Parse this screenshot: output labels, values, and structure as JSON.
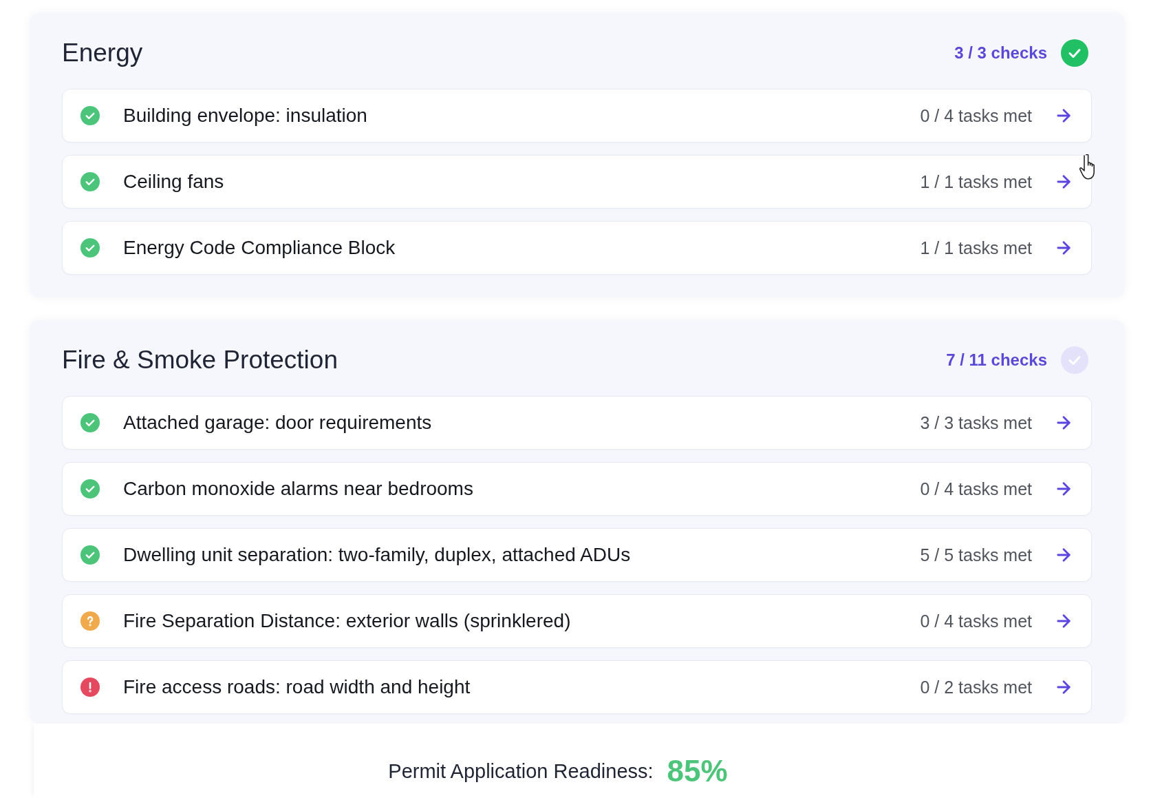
{
  "sections": [
    {
      "title": "Energy",
      "checks": "3 / 3 checks",
      "complete": true,
      "items": [
        {
          "kind": "met",
          "label": "Building envelope: insulation",
          "tasks": "0 / 4 tasks met"
        },
        {
          "kind": "met",
          "label": "Ceiling fans",
          "tasks": "1 / 1 tasks met"
        },
        {
          "kind": "met",
          "label": "Energy Code Compliance Block",
          "tasks": "1 / 1 tasks met"
        }
      ]
    },
    {
      "title": "Fire & Smoke Protection",
      "checks": "7 / 11 checks",
      "complete": false,
      "items": [
        {
          "kind": "met",
          "label": "Attached garage: door requirements",
          "tasks": "3 / 3 tasks met"
        },
        {
          "kind": "met",
          "label": "Carbon monoxide alarms near bedrooms",
          "tasks": "0 / 4 tasks met"
        },
        {
          "kind": "met",
          "label": "Dwelling unit separation: two-family, duplex, attached ADUs",
          "tasks": "5 / 5 tasks met"
        },
        {
          "kind": "unknown",
          "label": "Fire Separation Distance: exterior walls (sprinklered)",
          "tasks": "0 / 4 tasks met"
        },
        {
          "kind": "blocked",
          "label": "Fire access roads: road width and height",
          "tasks": "0 / 2 tasks met"
        }
      ]
    }
  ],
  "readiness": {
    "label": "Permit Application Readiness:",
    "value": "85%"
  }
}
